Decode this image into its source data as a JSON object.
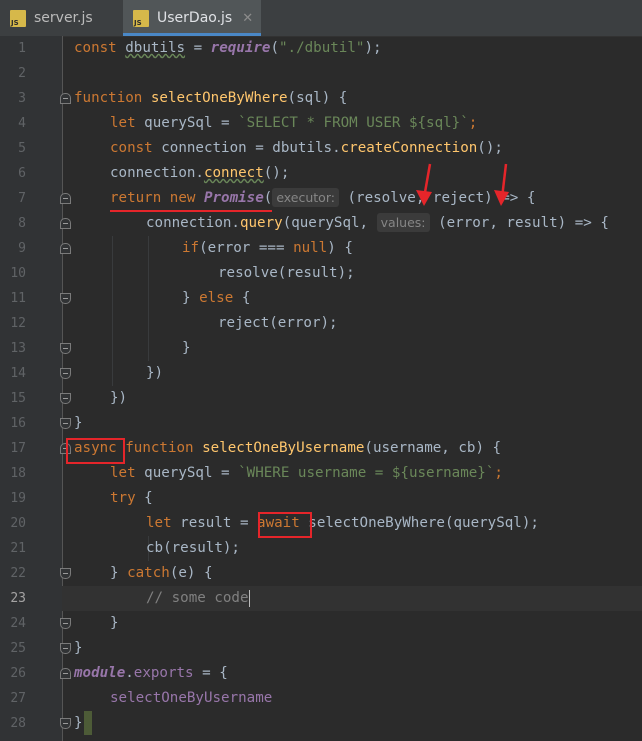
{
  "tabs": [
    {
      "label": "server.js",
      "icon": "js-file-icon",
      "active": false
    },
    {
      "label": "UserDao.js",
      "icon": "js-file-icon",
      "active": true
    }
  ],
  "current_line": 23,
  "lines": {
    "n1": "1",
    "n2": "2",
    "n3": "3",
    "n4": "4",
    "n5": "5",
    "n6": "6",
    "n7": "7",
    "n8": "8",
    "n9": "9",
    "n10": "10",
    "n11": "11",
    "n12": "12",
    "n13": "13",
    "n14": "14",
    "n15": "15",
    "n16": "16",
    "n17": "17",
    "n18": "18",
    "n19": "19",
    "n20": "20",
    "n21": "21",
    "n22": "22",
    "n23": "23",
    "n24": "24",
    "n25": "25",
    "n26": "26",
    "n27": "27",
    "n28": "28"
  },
  "code": {
    "l1": {
      "a": "const ",
      "b": "dbutils",
      " c": " = ",
      "d": "require",
      "e": "(",
      "f": "\"./dbutil\"",
      "g": ");"
    },
    "l3": {
      "a": "function ",
      "b": "selectOneByWhere",
      "c": "(sql) {"
    },
    "l4": {
      "a": "let ",
      "b": "querySql = ",
      "c": "`SELECT * FROM USER ${sql}`",
      "d": ";"
    },
    "l5": {
      "a": "const ",
      "b": "connection = dbutils.",
      "c": "createConnection",
      "d": "();"
    },
    "l6": {
      "a": "connection.",
      "b": "connect",
      "c": "();"
    },
    "l7": {
      "a": "return new ",
      "b": "Promise",
      "c": "(",
      "hint": "executor:",
      "d": "(resolve, reject) => {"
    },
    "l8": {
      "a": "connection.",
      "b": "query",
      "c": "(querySql, ",
      "hint": "values:",
      "d": "(error, result) => {"
    },
    "l9": {
      "a": "if",
      "b": "(error === ",
      "c": "null",
      "d": ") {"
    },
    "l10": {
      "a": "resolve(result);"
    },
    "l11": {
      "a": "} ",
      "b": "else ",
      "c": "{"
    },
    "l12": {
      "a": "reject(error);"
    },
    "l13": {
      "a": "}"
    },
    "l14": {
      "a": "})"
    },
    "l15": {
      "a": "})"
    },
    "l16": {
      "a": "}"
    },
    "l17": {
      "a": "async ",
      "b": "function ",
      "c": "selectOneByUsername",
      "d": "(username, cb) {"
    },
    "l18": {
      "a": "let ",
      "b": "querySql = ",
      "c": "`WHERE username = ${username}`",
      "d": ";"
    },
    "l19": {
      "a": "try ",
      "b": "{"
    },
    "l20": {
      "a": "let ",
      "b": "result = ",
      "c": "await ",
      "d": "selectOneByWhere(querySql);"
    },
    "l21": {
      "a": "cb(result);"
    },
    "l22": {
      "a": "} ",
      "b": "catch",
      "c": "(e) {"
    },
    "l23": {
      "a": "// some code"
    },
    "l24": {
      "a": "}"
    },
    "l25": {
      "a": "}"
    },
    "l26": {
      "a": "module",
      "b": ".",
      "c": "exports",
      " d": " = {"
    },
    "l27": {
      "a": "selectOneByUsername"
    },
    "l28": {
      "a": "}"
    }
  },
  "colors": {
    "keyword": "#cc7832",
    "function": "#ffc66d",
    "string": "#6a8759",
    "annotation_red": "#e5252a",
    "background": "#2b2b2b"
  }
}
